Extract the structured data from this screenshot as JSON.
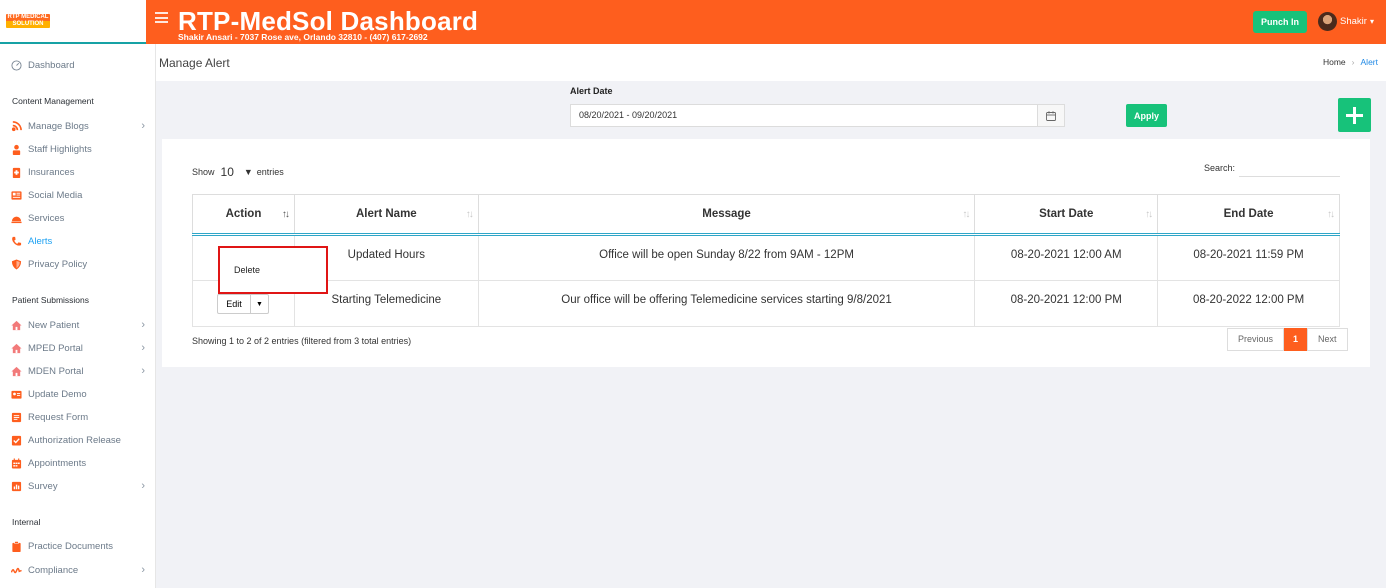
{
  "app": {
    "logo_text": "RTP MEDICAL SOLUTION",
    "title": "RTP-MedSol Dashboard",
    "subtitle": "Shakir Ansari - 7037 Rose ave, Orlando 32810 - (407) 617-2692",
    "punch_label": "Punch In",
    "user_name": "Shakir"
  },
  "colors": {
    "brand": "#fe5e1e",
    "accent_green": "#17c27a",
    "active_link": "#1da1f2"
  },
  "sidebar": {
    "dashboard": "Dashboard",
    "heading_content": "Content Management",
    "content_items": [
      {
        "label": "Manage Blogs",
        "icon": "blog-icon",
        "chevron": true
      },
      {
        "label": "Staff Highlights",
        "icon": "staff-icon"
      },
      {
        "label": "Insurances",
        "icon": "insurance-icon"
      },
      {
        "label": "Social Media",
        "icon": "social-icon"
      },
      {
        "label": "Services",
        "icon": "services-icon"
      },
      {
        "label": "Alerts",
        "icon": "phone-icon",
        "active": true
      },
      {
        "label": "Privacy Policy",
        "icon": "shield-icon"
      }
    ],
    "heading_patient": "Patient Submissions",
    "patient_items": [
      {
        "label": "New Patient",
        "icon": "home-icon",
        "chevron": true
      },
      {
        "label": "MPED Portal",
        "icon": "home-icon",
        "chevron": true
      },
      {
        "label": "MDEN Portal",
        "icon": "home-icon",
        "chevron": true
      },
      {
        "label": "Update Demo",
        "icon": "id-card-icon"
      },
      {
        "label": "Request Form",
        "icon": "form-icon"
      },
      {
        "label": "Authorization Release",
        "icon": "check-icon"
      },
      {
        "label": "Appointments",
        "icon": "calendar-icon"
      },
      {
        "label": "Survey",
        "icon": "chart-icon",
        "chevron": true
      }
    ],
    "heading_internal": "Internal",
    "internal_items": [
      {
        "label": "Practice Documents",
        "icon": "clipboard-icon"
      },
      {
        "label": "Compliance",
        "icon": "signature-icon",
        "chevron": true
      }
    ]
  },
  "page": {
    "title": "Manage Alert",
    "breadcrumb_home": "Home",
    "breadcrumb_current": "Alert"
  },
  "filter": {
    "label": "Alert Date",
    "date_range": "08/20/2021 - 09/20/2021",
    "apply_label": "Apply"
  },
  "table": {
    "show_label": "Show",
    "entries_value": "10",
    "entries_label": "entries",
    "search_label": "Search:",
    "columns": [
      "Action",
      "Alert Name",
      "Message",
      "Start Date",
      "End Date"
    ],
    "rows": [
      {
        "name": "Updated Hours",
        "message": "Office will be open Sunday 8/22 from 9AM - 12PM",
        "start": "08-20-2021 12:00 AM",
        "end": "08-20-2021 11:59 PM"
      },
      {
        "name": "Starting Telemedicine",
        "message": "Our office will be offering Telemedicine services starting 9/8/2021",
        "start": "08-20-2021 12:00 PM",
        "end": "08-20-2022 12:00 PM"
      }
    ],
    "edit_label": "Edit",
    "delete_label": "Delete",
    "info": "Showing 1 to 2 of 2 entries (filtered from 3 total entries)",
    "pager": {
      "previous": "Previous",
      "current": "1",
      "next": "Next"
    }
  }
}
